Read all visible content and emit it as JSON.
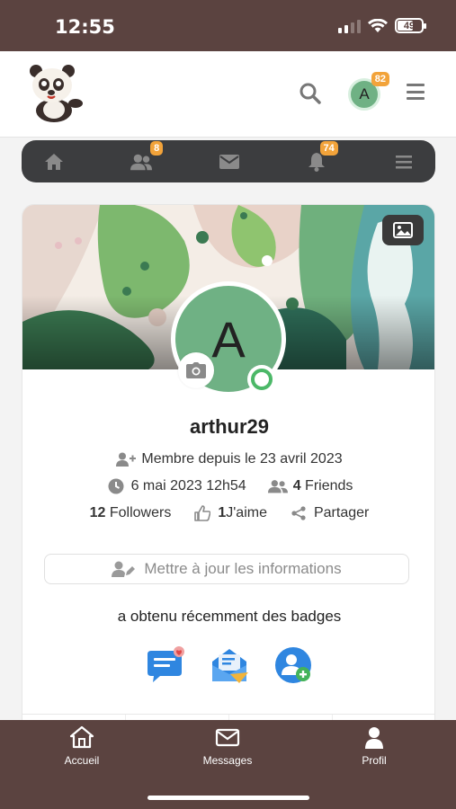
{
  "status_bar": {
    "time": "12:55",
    "battery": "49"
  },
  "header": {
    "logo_alt": "panda mascot",
    "avatar_initial": "A",
    "avatar_badge": "82"
  },
  "top_nav": {
    "friends_badge": "8",
    "notifications_badge": "74"
  },
  "profile": {
    "avatar_initial": "A",
    "username": "arthur29",
    "member_since": "Membre depuis le 23 avril 2023",
    "last_seen": "6 mai 2023 12h54",
    "friends_count": "4",
    "friends_label": "Friends",
    "followers_count": "12",
    "followers_label": "Followers",
    "likes_count": "1",
    "likes_label": "J'aime",
    "share_label": "Partager",
    "update_button": "Mettre à jour les informations",
    "badges_title": "a obtenu récemment des badges",
    "badges": [
      "messages-badge-icon",
      "mail-badge-icon",
      "add-user-badge-icon"
    ]
  },
  "tab_bar": {
    "items": [
      {
        "label": "Accueil",
        "icon": "home-icon"
      },
      {
        "label": "Messages",
        "icon": "envelope-icon"
      },
      {
        "label": "Profil",
        "icon": "user-icon"
      }
    ]
  },
  "colors": {
    "brand_brown": "#5b4340",
    "nav_dark": "#3c3d3f",
    "avatar_green": "#6fb184",
    "badge_orange": "#f2a33a",
    "online_green": "#4cb868"
  }
}
